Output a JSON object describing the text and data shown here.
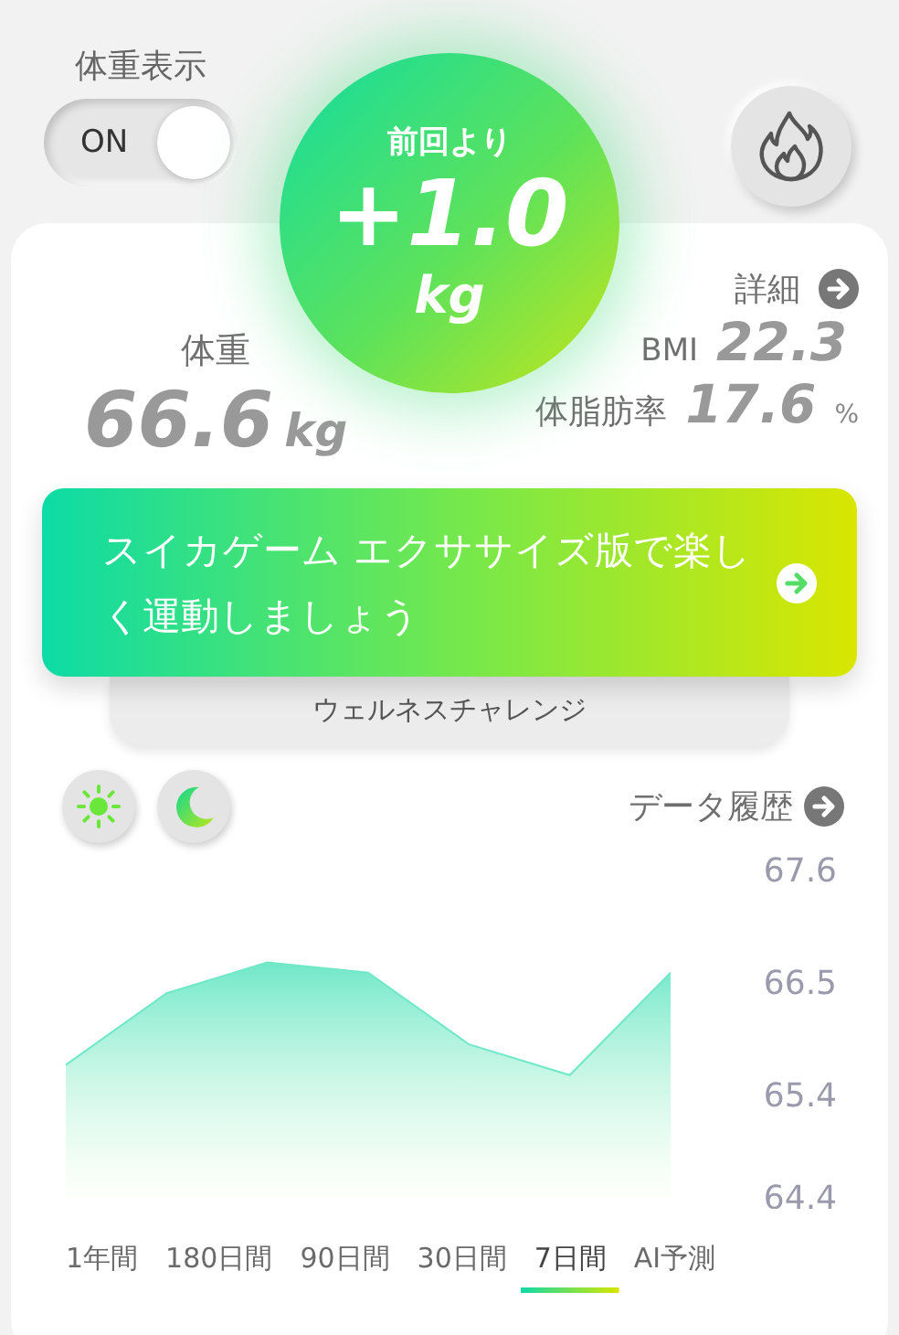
{
  "weight_display": {
    "label": "体重表示",
    "toggle": {
      "label": "ON",
      "on": true
    }
  },
  "change": {
    "label": "前回より",
    "value": "+1.0",
    "unit": "kg"
  },
  "weight": {
    "label": "体重",
    "value": "66.6",
    "unit": "kg"
  },
  "details_link": "詳細",
  "bmi": {
    "label": "BMI",
    "value": "22.3"
  },
  "body_fat": {
    "label": "体脂肪率",
    "value": "17.6",
    "unit": "%"
  },
  "banner": {
    "text": "スイカゲーム エクササイズ版で楽しく運動しましょう"
  },
  "wellness_tab": "ウェルネスチャレンジ",
  "history_link": "データ履歴",
  "chart": {
    "chart_data": {
      "type": "area",
      "categories": [
        null,
        null,
        null,
        null,
        null,
        null,
        null
      ],
      "series": [
        {
          "color": "#70e8c8",
          "values": [
            65.7,
            66.4,
            66.7,
            66.6,
            65.9,
            65.6,
            66.6
          ]
        }
      ],
      "ylim": [
        64.4,
        67.6
      ],
      "yticks": [
        64.4,
        65.4,
        66.5,
        67.6
      ]
    }
  },
  "periods": [
    {
      "label": "1年間",
      "selected": false
    },
    {
      "label": "180日間",
      "selected": false
    },
    {
      "label": "90日間",
      "selected": false
    },
    {
      "label": "30日間",
      "selected": false
    },
    {
      "label": "7日間",
      "selected": true
    },
    {
      "label": "AI予測",
      "selected": false
    }
  ]
}
